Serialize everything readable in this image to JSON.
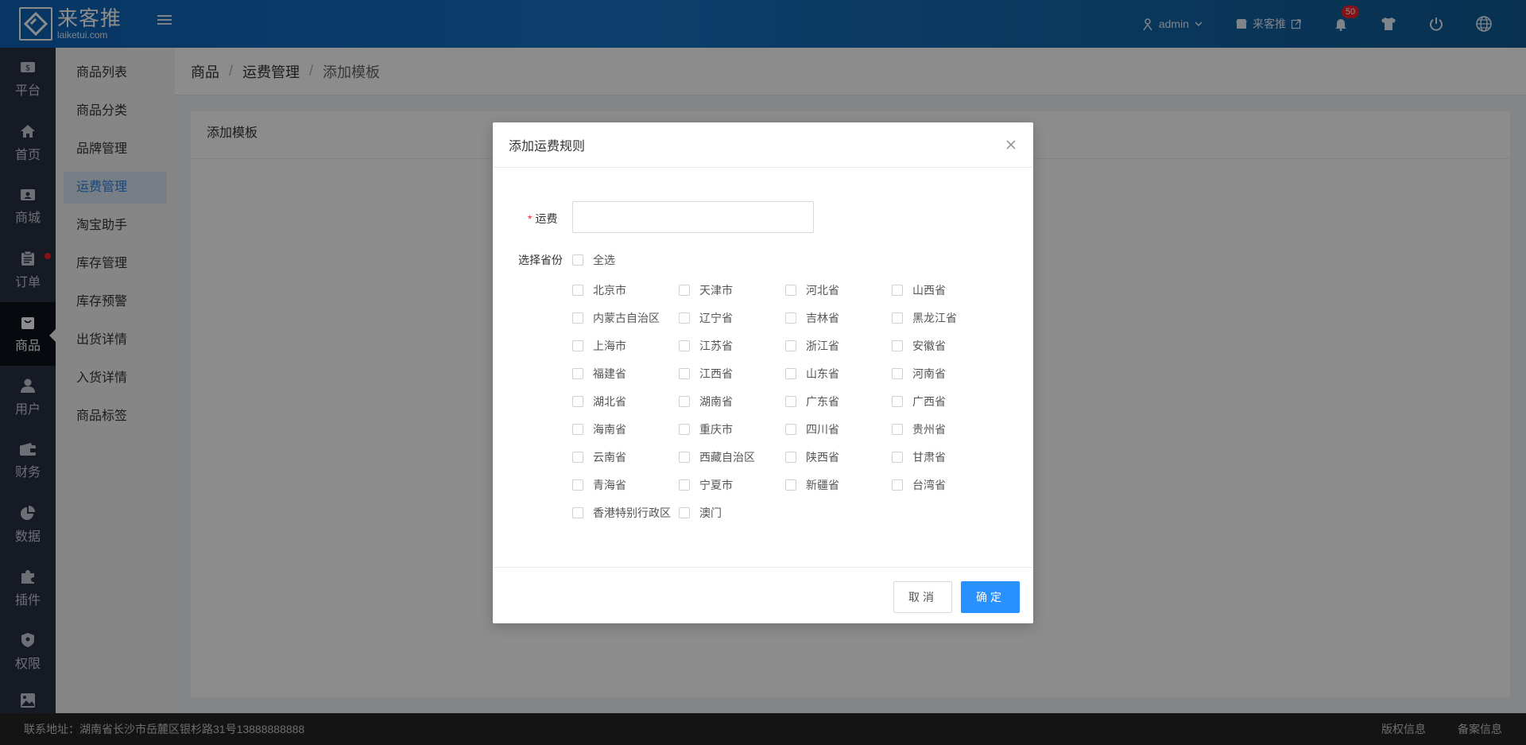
{
  "header": {
    "logo_cn": "来客推",
    "logo_en": "laiketui.com",
    "user": "admin",
    "store": "来客推",
    "notification_count": "50"
  },
  "nav": {
    "items": [
      {
        "label": "平台",
        "icon": "dollar-icon"
      },
      {
        "label": "首页",
        "icon": "home-icon"
      },
      {
        "label": "商城",
        "icon": "store-icon"
      },
      {
        "label": "订单",
        "icon": "clipboard-icon"
      },
      {
        "label": "商品",
        "icon": "bag-icon"
      },
      {
        "label": "用户",
        "icon": "user-icon"
      },
      {
        "label": "财务",
        "icon": "wallet-icon"
      },
      {
        "label": "数据",
        "icon": "pie-chart-icon"
      },
      {
        "label": "插件",
        "icon": "puzzle-icon"
      },
      {
        "label": "权限",
        "icon": "shield-icon"
      }
    ]
  },
  "submenu": {
    "items": [
      "商品列表",
      "商品分类",
      "品牌管理",
      "运费管理",
      "淘宝助手",
      "库存管理",
      "库存预警",
      "出货详情",
      "入货详情",
      "商品标签"
    ],
    "active_index": 3
  },
  "breadcrumb": {
    "a": "商品",
    "b": "运费管理",
    "c": "添加模板",
    "sep": "/"
  },
  "panel": {
    "title": "添加模板"
  },
  "modal": {
    "title": "添加运费规则",
    "fee_label": "运费",
    "fee_value": "",
    "province_label": "选择省份",
    "select_all": "全选",
    "provinces": [
      "北京市",
      "天津市",
      "河北省",
      "山西省",
      "内蒙古自治区",
      "辽宁省",
      "吉林省",
      "黑龙江省",
      "上海市",
      "江苏省",
      "浙江省",
      "安徽省",
      "福建省",
      "江西省",
      "山东省",
      "河南省",
      "湖北省",
      "湖南省",
      "广东省",
      "广西省",
      "海南省",
      "重庆市",
      "四川省",
      "贵州省",
      "云南省",
      "西藏自治区",
      "陕西省",
      "甘肃省",
      "青海省",
      "宁夏市",
      "新疆省",
      "台湾省",
      "香港特别行政区",
      "澳门"
    ],
    "cancel_label": "取消",
    "ok_label": "确定"
  },
  "footer": {
    "address": "联系地址：湖南省长沙市岳麓区银杉路31号13888888888",
    "copyright": "版权信息",
    "icp": "备案信息"
  },
  "colors": {
    "primary": "#2890ff",
    "nav_bg": "#273142",
    "header_start": "#0d62b6",
    "badge": "#f5222d"
  }
}
